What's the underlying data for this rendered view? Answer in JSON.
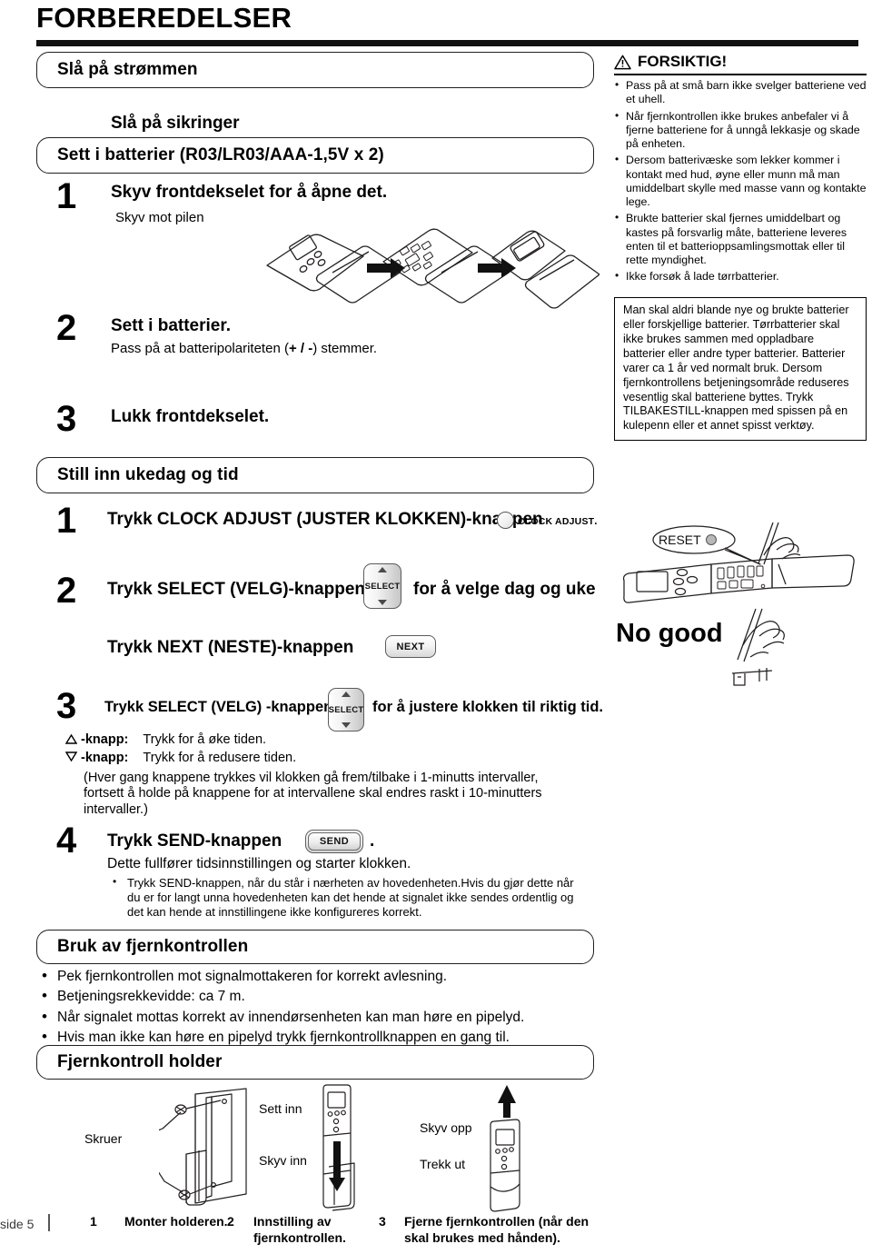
{
  "page": {
    "title": "FORBEREDELSER",
    "footer_label": "side 5"
  },
  "sections": {
    "power_on": "Slå på strømmen",
    "fuses": "Slå på sikringer",
    "batteries": "Sett i batterier (R03/LR03/AAA-1,5V x 2)",
    "set_clock": "Still inn ukedag og tid",
    "remote_use": "Bruk av fjernkontrollen",
    "remote_holder": "Fjernkontroll holder"
  },
  "battery_steps": [
    {
      "num": "1",
      "title": "Skyv frontdekselet for å åpne det.",
      "sub": "Skyv mot pilen"
    },
    {
      "num": "2",
      "title": "Sett i batterier.",
      "sub_pre": "Pass på at batteripolariteten (",
      "sub_bold": "+ / -",
      "sub_post": ") stemmer."
    },
    {
      "num": "3",
      "title": "Lukk frontdekselet.",
      "sub": ""
    }
  ],
  "clock_steps": {
    "s1_num": "1",
    "s1_text": "Trykk CLOCK ADJUST (JUSTER KLOKKEN)-knappen",
    "s1_button_label": "CLOCK ADJUST",
    "s1_period": ".",
    "s2_num": "2",
    "s2_text_a": "Trykk SELECT (VELG)-knappen",
    "s2_button_label": "SELECT",
    "s2_text_b": "for å velge dag og uke",
    "s2b_text": "Trykk NEXT (NESTE)-knappen",
    "s2b_button_label": "NEXT",
    "s3_num": "3",
    "s3_text_a": "Trykk SELECT (VELG) -knappene",
    "s3_button_label": "SELECT",
    "s3_text_b": "for å justere klokken til riktig tid.",
    "s3_up_label": "-knapp:",
    "s3_up_desc": "Trykk for å øke tiden.",
    "s3_dn_label": "-knapp:",
    "s3_dn_desc": "Trykk for å redusere tiden.",
    "s3_note": "(Hver gang knappene trykkes vil klokken gå frem/tilbake i 1-minutts intervaller, fortsett å holde på knappene for at intervallene skal endres raskt i 10-minutters intervaller.)",
    "s4_num": "4",
    "s4_text": "Trykk SEND-knappen",
    "s4_button_label": "SEND",
    "s4_period": ".",
    "s4_sub": "Dette fullfører tidsinnstillingen og starter klokken.",
    "s4_bullet": "Trykk SEND-knappen, når du står i nærheten av hovedenheten.Hvis du gjør dette når du er for langt unna hovedenheten kan det hende at signalet ikke sendes ordentlig og det kan hende at innstillingene ikke konfigureres korrekt."
  },
  "remote_use_bullets": [
    "Pek fjernkontrollen mot signalmottakeren for korrekt avlesning.",
    "Betjeningsrekkevidde: ca 7 m.",
    "Når signalet mottas korrekt av innendørsenheten kan man høre en pipelyd.",
    "Hvis man ikke kan høre en pipelyd trykk fjernkontrollknappen en gang til."
  ],
  "caution": {
    "title": "FORSIKTIG!",
    "items": [
      "Pass på at små barn ikke svelger batteriene ved et uhell.",
      "Når fjernkontrollen ikke brukes anbefaler vi å fjerne batteriene for å unngå lekkasje og skade på enheten.",
      "Dersom batterivæske som lekker kommer i kontakt med hud, øyne eller munn må man umiddelbart skylle med masse vann og kontakte lege.",
      "Brukte batterier skal fjernes umiddelbart og kastes på forsvarlig måte, batteriene leveres enten til et batterioppsamlingsmottak eller til rette myndighet.",
      "Ikke forsøk å lade tørrbatterier."
    ],
    "note": "Man skal aldri blande nye og brukte batterier eller forskjellige batterier. Tørrbatterier skal ikke brukes sammen med oppladbare batterier eller andre typer batterier. Batterier varer ca 1 år ved normalt bruk. Dersom fjernkontrollens betjeningsområde reduseres vesentlig skal batteriene byttes. Trykk TILBAKESTILL-knappen med spissen på en kulepenn eller et annet spisst verktøy."
  },
  "reset_illustration": {
    "callout": "RESET",
    "no_good": "No good"
  },
  "holder_diagram": {
    "labels": {
      "screws": "Skruer",
      "insert": "Sett inn",
      "push_in": "Skyv inn",
      "slide_up": "Skyv opp",
      "pull_out": "Trekk ut"
    },
    "captions": [
      {
        "num": "1",
        "text": "Monter holderen."
      },
      {
        "num": "2",
        "text": "Innstilling av fjernkontrollen."
      },
      {
        "num": "3",
        "text": "Fjerne fjernkontrollen (når den skal brukes med hånden)."
      }
    ]
  }
}
